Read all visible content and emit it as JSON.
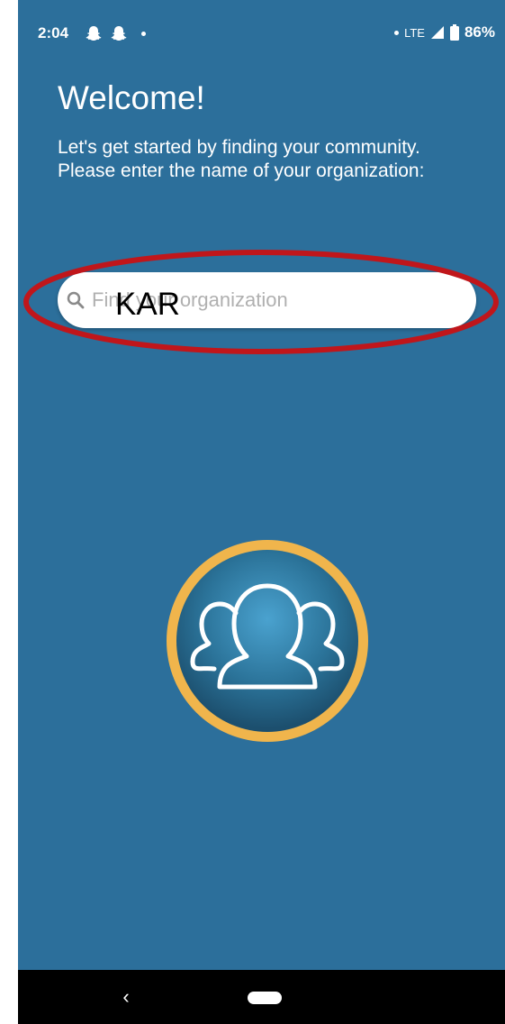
{
  "status_bar": {
    "time": "2:04",
    "network": "LTE",
    "battery": "86%",
    "icons": [
      "snapchat-ghost-icon",
      "snapchat-ghost-icon",
      "notification-dot-icon"
    ]
  },
  "welcome": {
    "title": "Welcome!",
    "intro": "Let's get started by finding your community. Please enter the name of your organization:"
  },
  "search": {
    "placeholder": "Find your organization",
    "value": "",
    "overlay_text": "KAR",
    "icon": "search-icon"
  },
  "logo": {
    "icon": "community-people-icon",
    "ring_color": "#f0b54c",
    "inner_color": "#2b7399"
  },
  "annotation": {
    "ellipse_color": "#c0161b"
  },
  "nav": {
    "back_label": "‹"
  },
  "colors": {
    "background": "#2c6f9b",
    "nav_bar": "#000000"
  }
}
